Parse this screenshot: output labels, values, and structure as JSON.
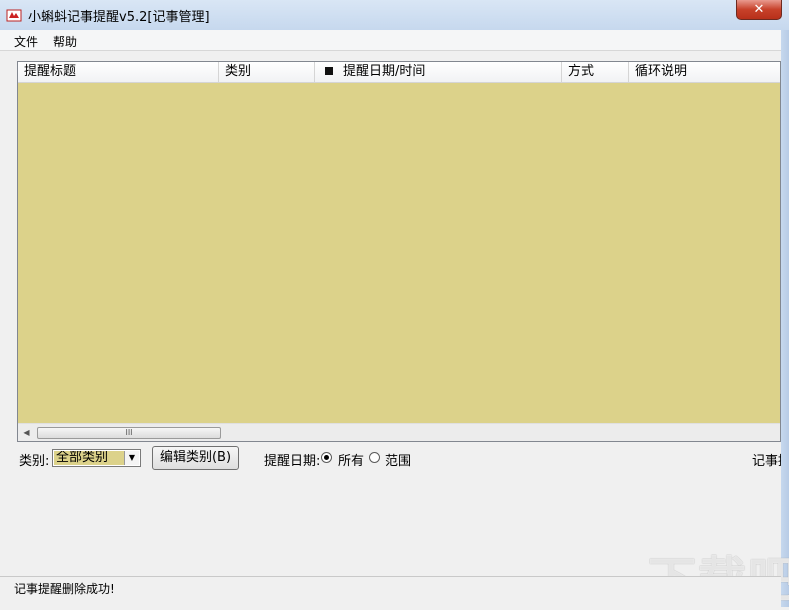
{
  "window": {
    "title": "小蝌蚪记事提醒v5.2[记事管理]",
    "close_label": "✕"
  },
  "menu": {
    "items": [
      {
        "label": "文件"
      },
      {
        "label": "帮助"
      }
    ]
  },
  "list": {
    "columns": [
      {
        "label": "提醒标题"
      },
      {
        "label": "类别"
      },
      {
        "label": "提醒日期/时间"
      },
      {
        "label": "方式"
      },
      {
        "label": "循环说明"
      }
    ],
    "scroll_thumb_label": "III"
  },
  "filters": {
    "category_label": "类别:",
    "category_value": "全部类别",
    "edit_category_button": "编辑类别(B)",
    "date_label": "提醒日期:",
    "date_options": [
      {
        "label": "所有",
        "checked": true
      },
      {
        "label": "范围",
        "checked": false
      }
    ],
    "right_clipped_label": "记事提"
  },
  "status": {
    "text": "记事提醒删除成功!"
  },
  "watermark": "下载吧",
  "colors": {
    "list_background": "#dcd28a",
    "titlebar": "#c6d8ee",
    "close_button": "#c7412a"
  }
}
